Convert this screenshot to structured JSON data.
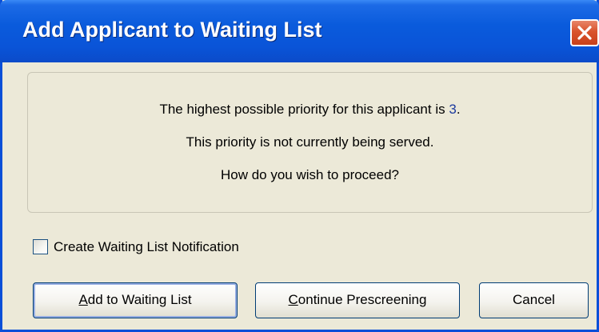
{
  "window": {
    "title": "Add Applicant to Waiting List"
  },
  "message": {
    "line1_prefix": "The highest possible priority for this applicant is ",
    "priority": "3",
    "line1_suffix": ".",
    "line2": "This priority is not currently being served.",
    "line3": "How do you wish to proceed?"
  },
  "notification_checkbox": {
    "label": "Create Waiting List Notification",
    "checked": false
  },
  "buttons": {
    "add": {
      "mnemonic": "A",
      "rest": "dd to Waiting List"
    },
    "continue": {
      "mnemonic": "C",
      "rest": "ontinue Prescreening"
    },
    "cancel": {
      "label": "Cancel"
    }
  },
  "colors": {
    "titlebar": "#0a54d8",
    "dialog_background": "#ece9d8",
    "priority_value": "#1c3a9e",
    "close_button": "#d9532c"
  }
}
